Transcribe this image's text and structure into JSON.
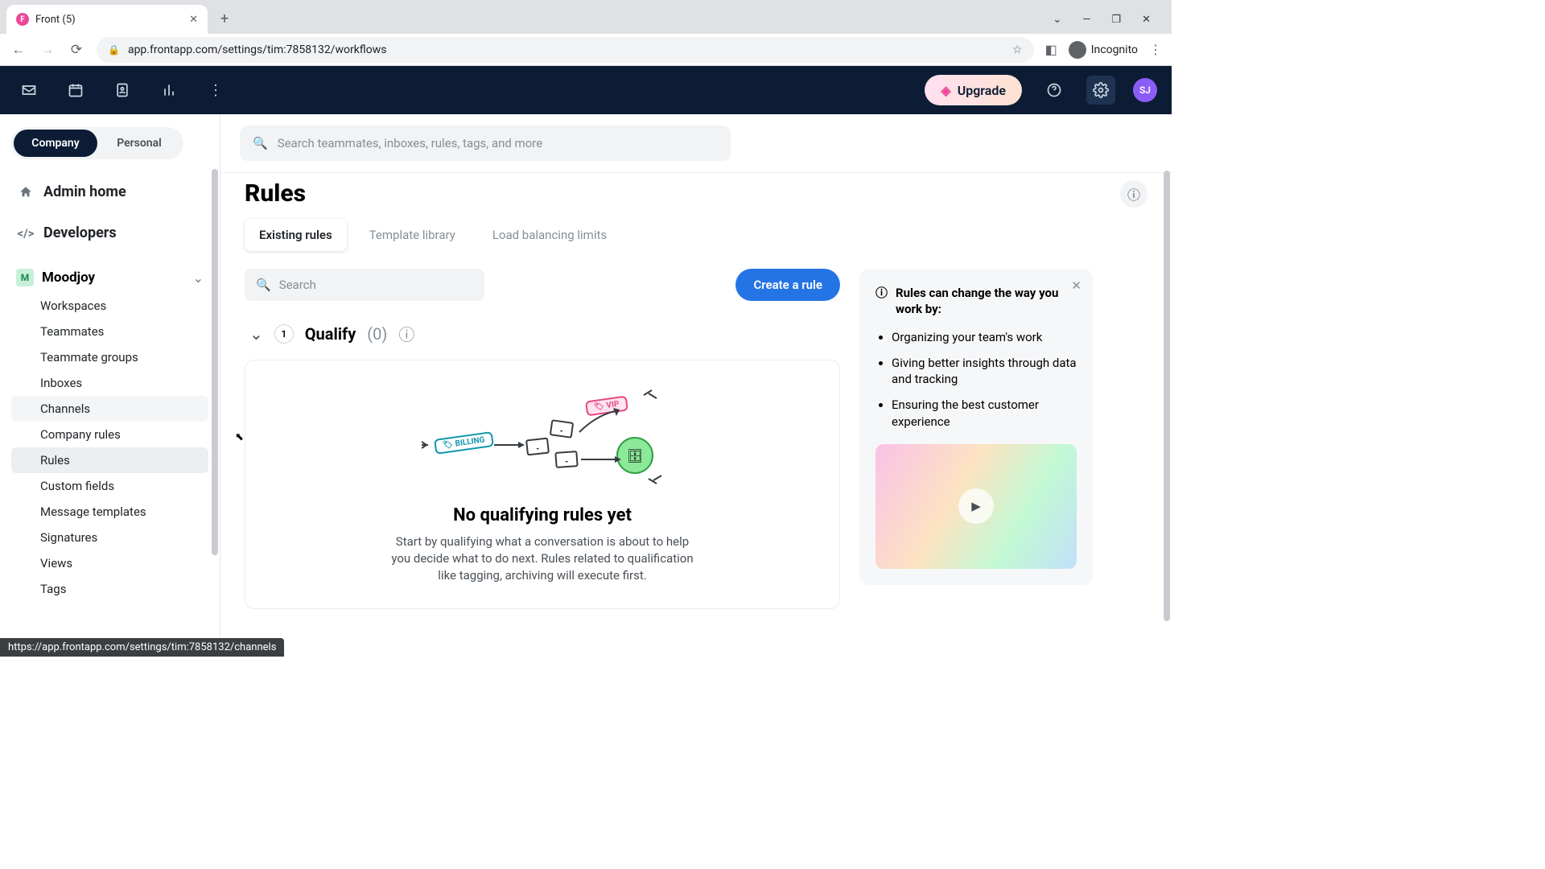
{
  "browser": {
    "tab_title": "Front (5)",
    "url": "app.frontapp.com/settings/tim:7858132/workflows",
    "incognito": "Incognito",
    "status_url": "https://app.frontapp.com/settings/tim:7858132/channels"
  },
  "header": {
    "upgrade": "Upgrade",
    "avatar": "SJ"
  },
  "sidebar": {
    "toggle": {
      "company": "Company",
      "personal": "Personal"
    },
    "admin_home": "Admin home",
    "developers": "Developers",
    "org_name": "Moodjoy",
    "org_initial": "M",
    "items": [
      "Workspaces",
      "Teammates",
      "Teammate groups",
      "Inboxes",
      "Channels",
      "Company rules",
      "Rules",
      "Custom fields",
      "Message templates",
      "Signatures",
      "Views",
      "Tags"
    ]
  },
  "search": {
    "placeholder": "Search teammates, inboxes, rules, tags, and more"
  },
  "page": {
    "title": "Rules",
    "tabs": [
      "Existing rules",
      "Template library",
      "Load balancing limits"
    ],
    "mini_search_placeholder": "Search",
    "create_btn": "Create a rule",
    "section": {
      "num": "1",
      "name": "Qualify",
      "count": "(0)"
    },
    "empty": {
      "title": "No qualifying rules yet",
      "desc": "Start by qualifying what a conversation is about to help you decide what to do next. Rules related to qualification like tagging, archiving will execute first."
    },
    "illus": {
      "vip": "VIP",
      "billing": "BILLING"
    }
  },
  "panel": {
    "title": "Rules can change the way you work by:",
    "bullets": [
      "Organizing your team's work",
      "Giving better insights through data and tracking",
      "Ensuring the best customer experience"
    ]
  }
}
